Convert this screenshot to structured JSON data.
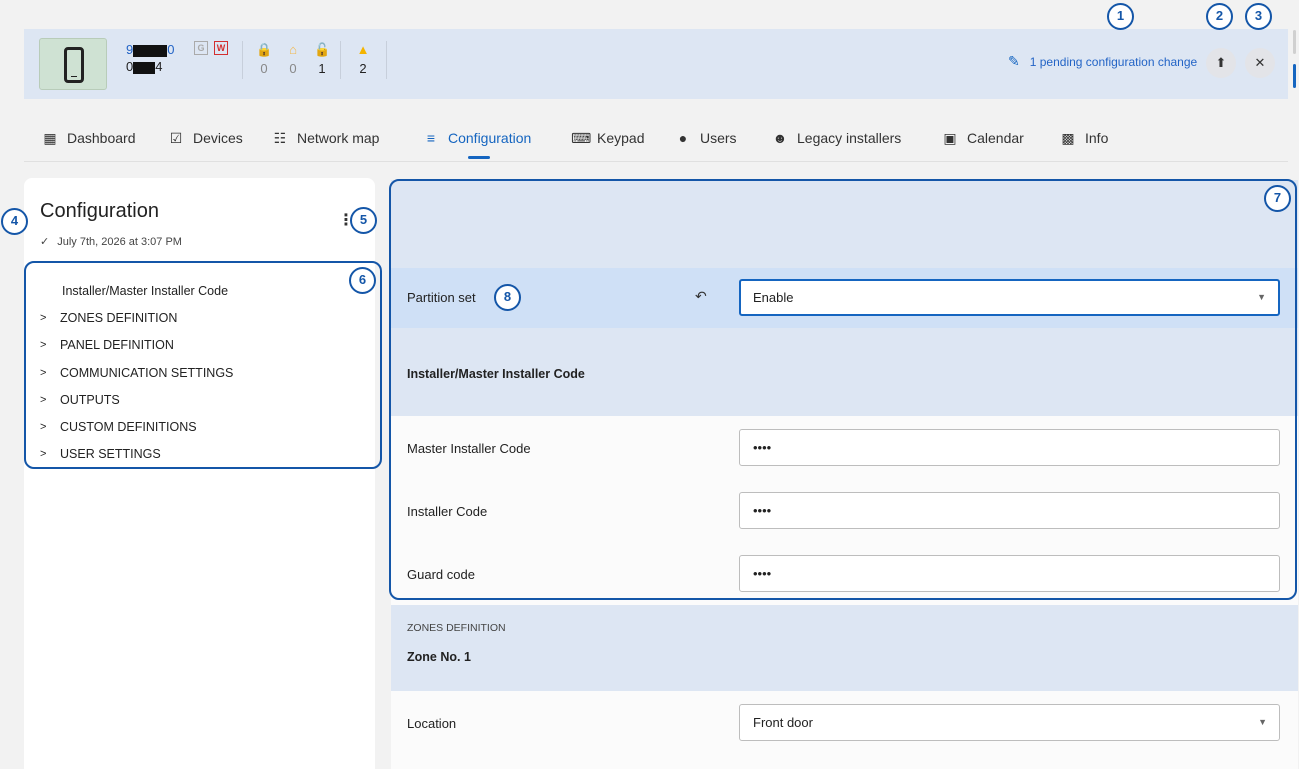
{
  "device": {
    "serial_prefix": "9",
    "serial_suffix": "0",
    "id_prefix": "0",
    "id_suffix": "4",
    "tag_g": "G",
    "tag_w": "W"
  },
  "status": {
    "lock_red_count": "0",
    "home_count": "0",
    "unlock_count": "1",
    "warning_count": "2"
  },
  "header": {
    "pending_text": "1 pending configuration change"
  },
  "tabs": [
    {
      "label": "Dashboard",
      "icon": "dashboard-icon"
    },
    {
      "label": "Devices",
      "icon": "devices-icon"
    },
    {
      "label": "Network map",
      "icon": "network-map-icon"
    },
    {
      "label": "Configuration",
      "icon": "configuration-icon"
    },
    {
      "label": "Keypad",
      "icon": "keypad-icon"
    },
    {
      "label": "Users",
      "icon": "users-icon"
    },
    {
      "label": "Legacy installers",
      "icon": "legacy-installers-icon"
    },
    {
      "label": "Calendar",
      "icon": "calendar-icon"
    },
    {
      "label": "Info",
      "icon": "info-icon"
    }
  ],
  "left_panel": {
    "title": "Configuration",
    "date": "July 7th, 2026 at 3:07 PM",
    "tree": [
      "Installer/Master Installer Code",
      "ZONES DEFINITION",
      "PANEL DEFINITION",
      "COMMUNICATION SETTINGS",
      "OUTPUTS",
      "CUSTOM DEFINITIONS",
      "USER SETTINGS"
    ]
  },
  "form": {
    "partition_label": "Partition set",
    "partition_value": "Enable",
    "section_installer": "Installer/Master Installer Code",
    "master_code_label": "Master Installer Code",
    "master_code_value": "••••",
    "installer_code_label": "Installer Code",
    "installer_code_value": "••••",
    "guard_code_label": "Guard code",
    "guard_code_value": "••••",
    "zones_section": "ZONES DEFINITION",
    "zone_title": "Zone No. 1",
    "location_label": "Location",
    "location_value": "Front door"
  },
  "annotations": [
    "1",
    "2",
    "3",
    "4",
    "5",
    "6",
    "7",
    "8"
  ],
  "colors": {
    "accent": "#1565c0",
    "annotation": "#1456a8",
    "band": "#dde6f3",
    "highlight_row": "#cfe0f6"
  }
}
